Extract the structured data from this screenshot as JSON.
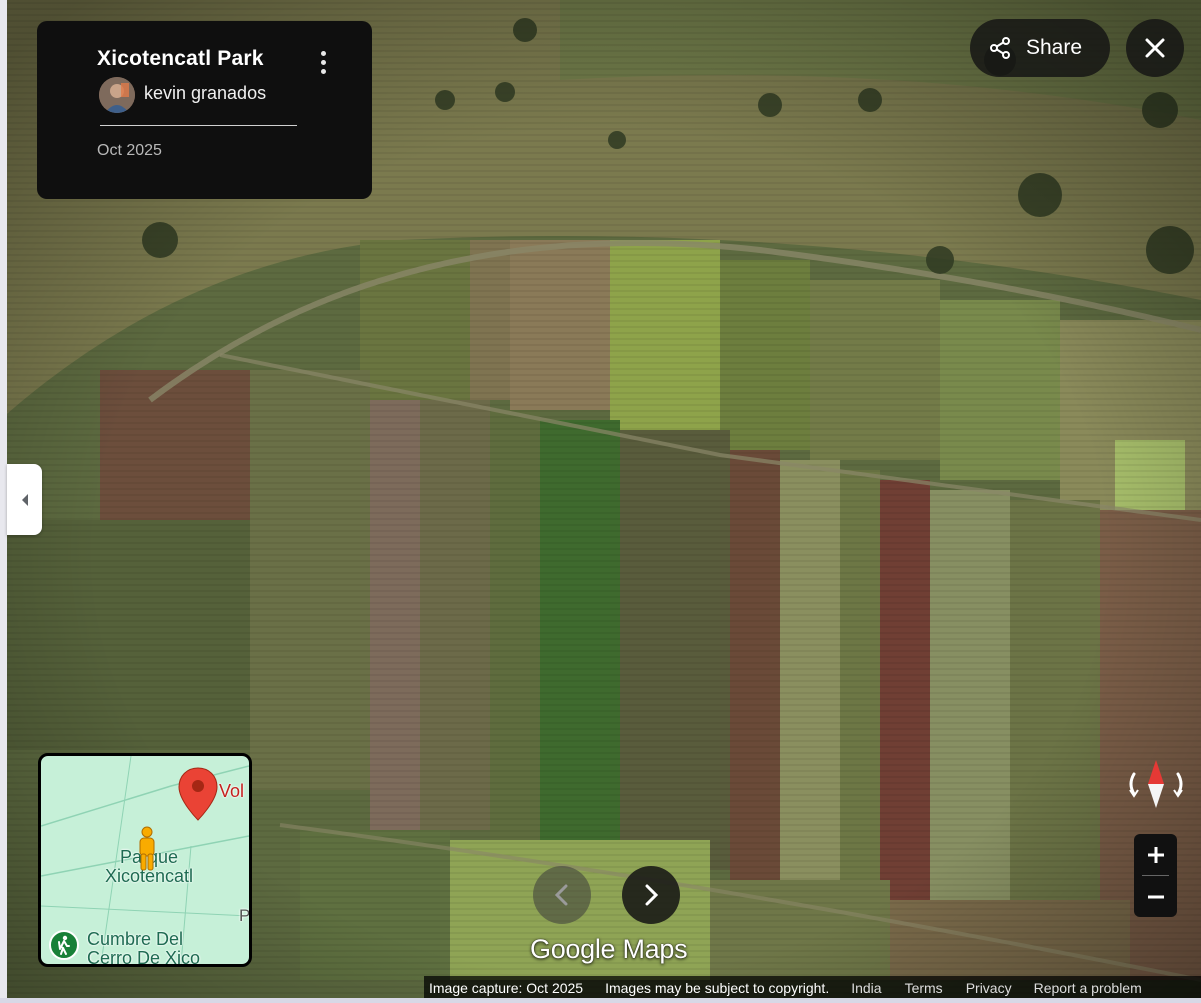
{
  "place": {
    "title": "Xicotencatl Park",
    "author": "kevin granados",
    "date": "Oct 2025"
  },
  "share": {
    "label": "Share"
  },
  "minimap": {
    "label_parque": "Parque Xicotencatl",
    "label_cumbre": "Cumbre Del Cerro De Xico",
    "label_vol": "Vol",
    "label_p": "P"
  },
  "logo": {
    "text": "Google Maps"
  },
  "footer": {
    "capture": "Image capture: Oct 2025",
    "copyright": "Images may be subject to copyright.",
    "region": "India",
    "terms": "Terms",
    "privacy": "Privacy",
    "report": "Report a problem"
  },
  "colors": {
    "marker": "#ea4335",
    "compass_red": "#e53935",
    "map_bg": "#c6f0d8"
  }
}
